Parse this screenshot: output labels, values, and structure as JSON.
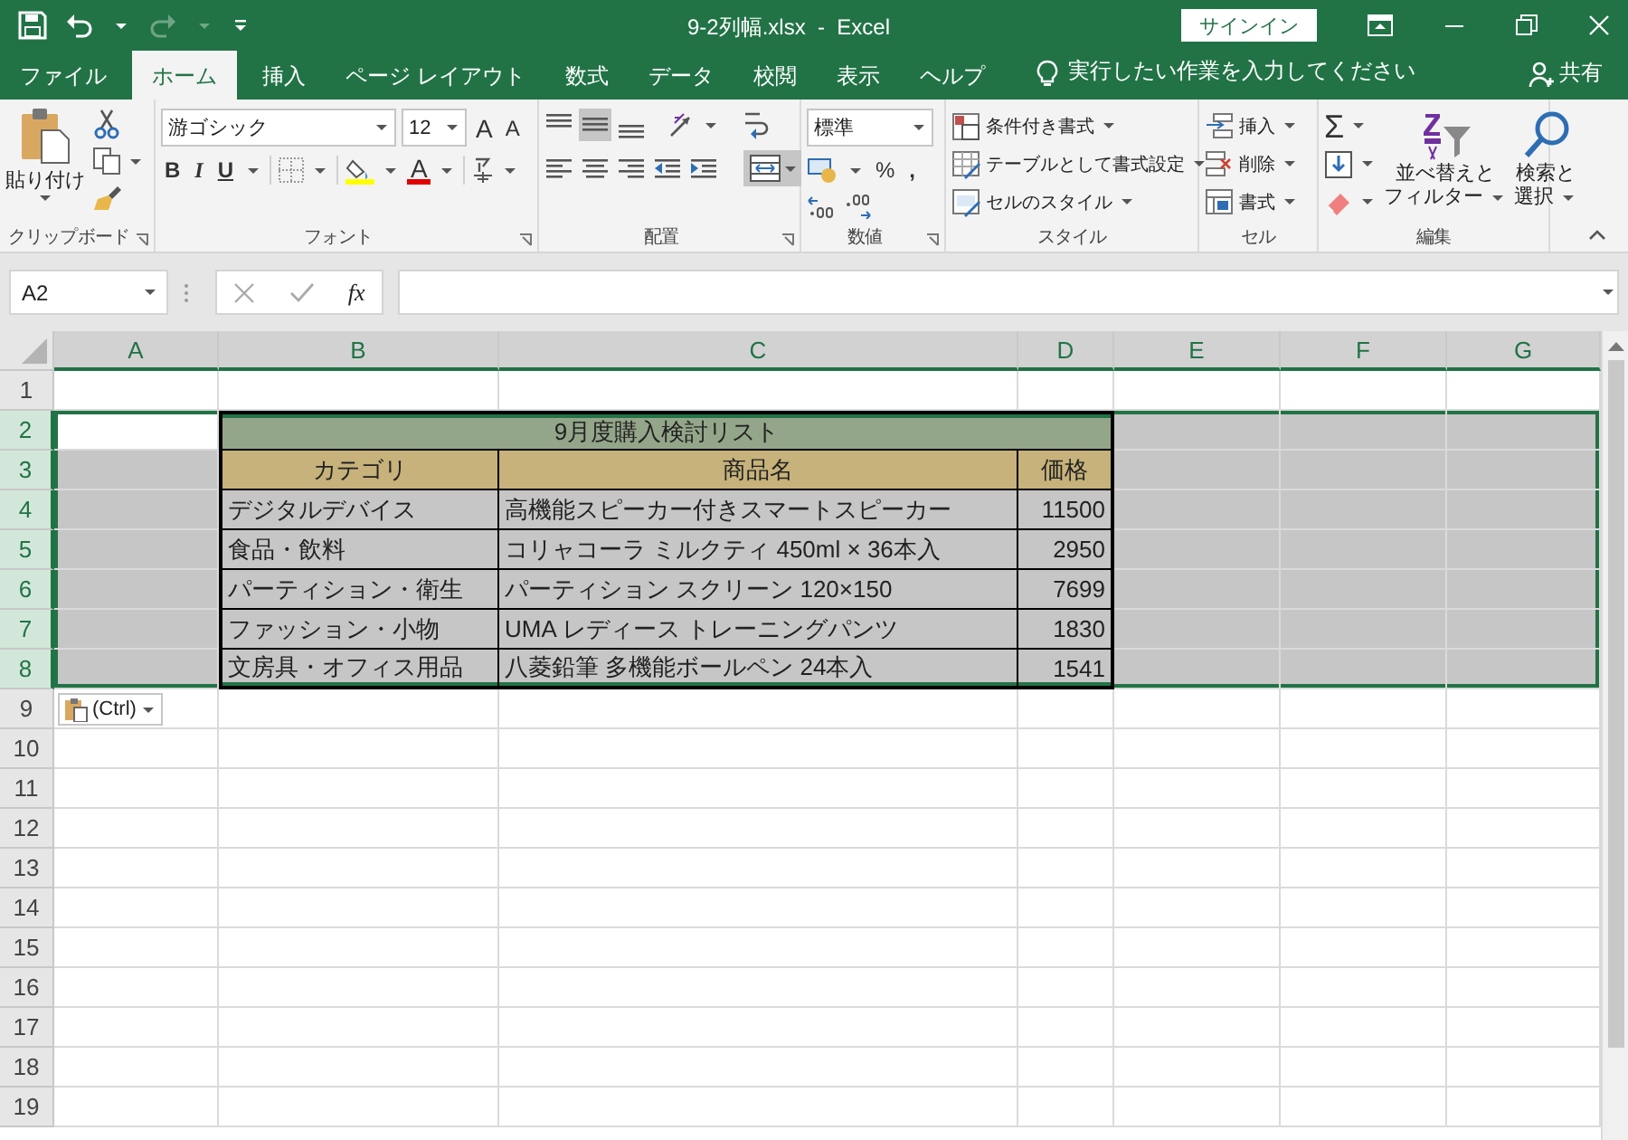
{
  "window": {
    "title": "9-2列幅.xlsx  -  Excel",
    "signin": "サインイン"
  },
  "tabs": [
    {
      "label": "ファイル",
      "selected": false
    },
    {
      "label": "ホーム",
      "selected": true
    },
    {
      "label": "挿入",
      "selected": false
    },
    {
      "label": "ページ レイアウト",
      "selected": false
    },
    {
      "label": "数式",
      "selected": false
    },
    {
      "label": "データ",
      "selected": false
    },
    {
      "label": "校閲",
      "selected": false
    },
    {
      "label": "表示",
      "selected": false
    },
    {
      "label": "ヘルプ",
      "selected": false
    }
  ],
  "tell_me": "実行したい作業を入力してください",
  "share": "共有",
  "ribbon": {
    "clipboard": {
      "paste": "貼り付け",
      "label": "クリップボード"
    },
    "font": {
      "name": "游ゴシック",
      "size": "12",
      "grow": "A",
      "shrink": "A",
      "bold": "B",
      "italic": "I",
      "underline": "U",
      "font_color_letter": "A",
      "label": "フォント"
    },
    "alignment": {
      "label": "配置"
    },
    "number": {
      "format": "標準",
      "percent": "%",
      "comma": ",",
      "label": "数値"
    },
    "styles": {
      "items": [
        "条件付き書式",
        "テーブルとして書式設定",
        "セルのスタイル"
      ],
      "label": "スタイル"
    },
    "cells": {
      "items": [
        "挿入",
        "削除",
        "書式"
      ],
      "label": "セル"
    },
    "editing": {
      "sum": "Σ",
      "sort": [
        "並べ替えと",
        "フィルター"
      ],
      "find": [
        "検索と",
        "選択"
      ],
      "label": "編集"
    }
  },
  "formula_bar": {
    "name_box": "A2",
    "fx": "fx"
  },
  "sheet": {
    "columns": [
      {
        "label": "A",
        "selected": true
      },
      {
        "label": "B",
        "selected": true
      },
      {
        "label": "C",
        "selected": true
      },
      {
        "label": "D",
        "selected": true
      },
      {
        "label": "E",
        "selected": true
      },
      {
        "label": "F",
        "selected": true
      },
      {
        "label": "G",
        "selected": true
      }
    ],
    "rows": [
      {
        "label": "1",
        "selected": false
      },
      {
        "label": "2",
        "selected": true
      },
      {
        "label": "3",
        "selected": true
      },
      {
        "label": "4",
        "selected": true
      },
      {
        "label": "5",
        "selected": true
      },
      {
        "label": "6",
        "selected": true
      },
      {
        "label": "7",
        "selected": true
      },
      {
        "label": "8",
        "selected": true
      },
      {
        "label": "9",
        "selected": false
      },
      {
        "label": "10",
        "selected": false
      },
      {
        "label": "11",
        "selected": false
      },
      {
        "label": "12",
        "selected": false
      },
      {
        "label": "13",
        "selected": false
      },
      {
        "label": "14",
        "selected": false
      },
      {
        "label": "15",
        "selected": false
      },
      {
        "label": "16",
        "selected": false
      },
      {
        "label": "17",
        "selected": false
      },
      {
        "label": "18",
        "selected": false
      },
      {
        "label": "19",
        "selected": false
      }
    ],
    "table": {
      "title": "9月度購入検討リスト",
      "headers": [
        "カテゴリ",
        "商品名",
        "価格"
      ],
      "rows": [
        [
          "デジタルデバイス",
          "高機能スピーカー付きスマートスピーカー",
          "11500"
        ],
        [
          "食品・飲料",
          "コリャコーラ ミルクティ 450ml × 36本入",
          "2950"
        ],
        [
          "パーティション・衛生",
          "パーティション スクリーン 120×150",
          "7699"
        ],
        [
          "ファッション・小物",
          "UMA レディース トレーニングパンツ",
          "1830"
        ],
        [
          "文房具・オフィス用品",
          "八菱鉛筆 多機能ボールペン 24本入",
          "1541"
        ]
      ]
    },
    "paste_options": "(Ctrl)"
  }
}
